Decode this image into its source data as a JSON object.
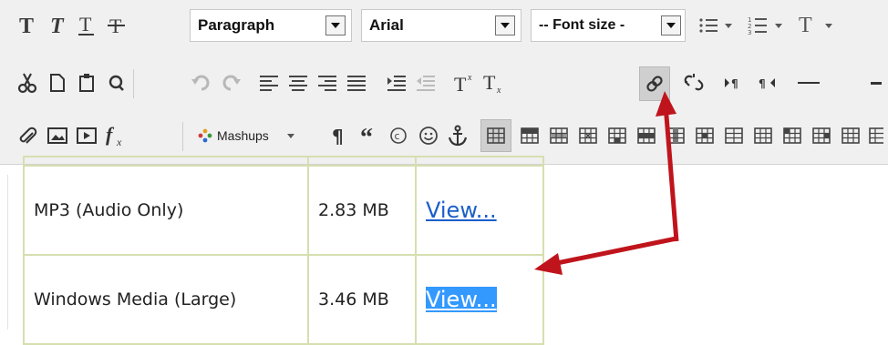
{
  "toolbar": {
    "paragraph_select": "Paragraph",
    "font_select": "Arial",
    "font_size_select": "-- Font size -",
    "mashups_label": "Mashups"
  },
  "table": {
    "rows": [
      {
        "format": "MP3 (Audio Only)",
        "size": "2.83 MB",
        "link": "View..."
      },
      {
        "format": "Windows Media (Large)",
        "size": "3.46 MB",
        "link": "View..."
      }
    ]
  },
  "colors": {
    "annotation_arrow": "#c0141c",
    "link_blue": "#1a5fc8",
    "selection_blue": "#3399ff",
    "table_border": "#d6dfb0"
  }
}
